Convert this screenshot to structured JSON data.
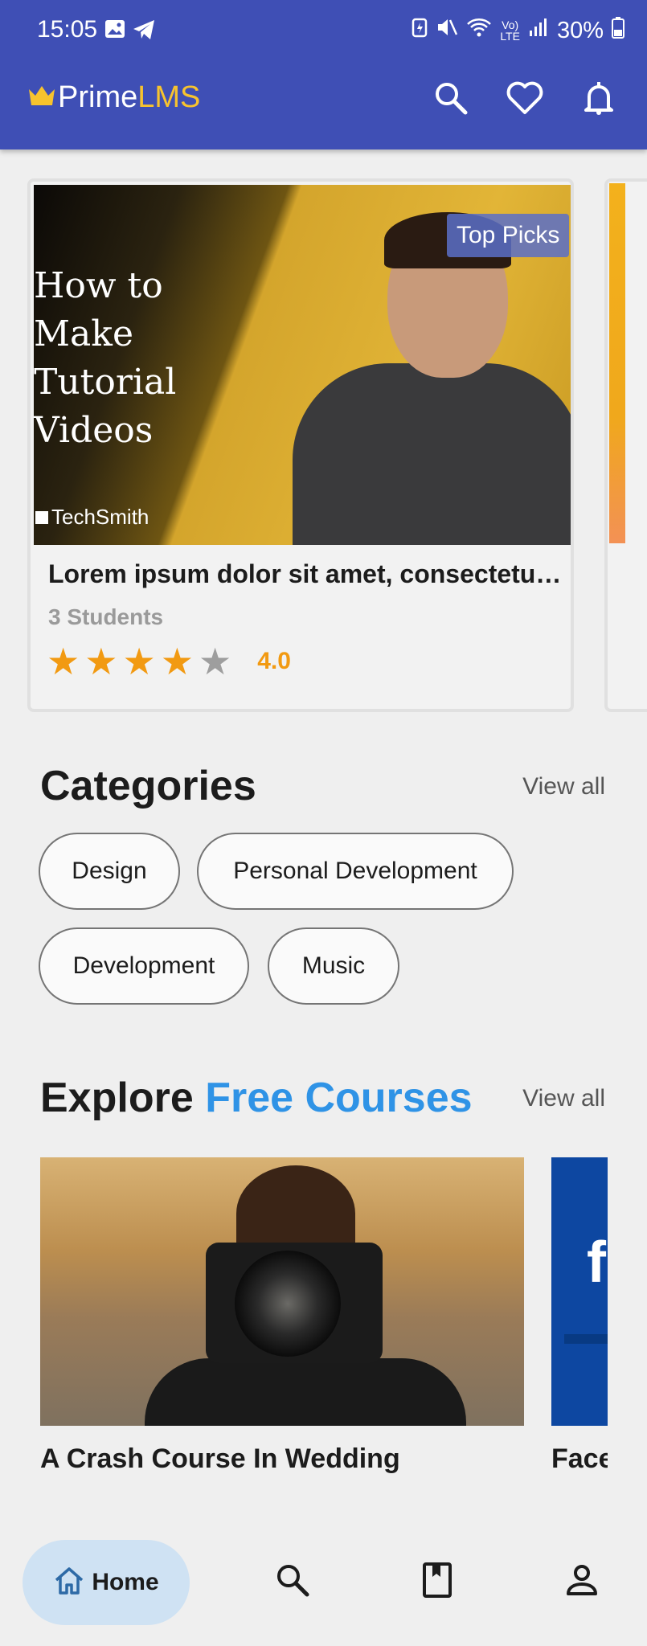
{
  "status_bar": {
    "time": "15:05",
    "battery": "30%",
    "icons": [
      "gallery-icon",
      "telegram-icon",
      "battery-saver-icon",
      "mute-icon",
      "wifi-icon",
      "volte-icon",
      "signal-icon",
      "battery-icon"
    ]
  },
  "app_bar": {
    "brand_part1": "Prime",
    "brand_part2": "LMS",
    "brand_icon": "crown-icon",
    "actions": [
      "search-icon",
      "heart-icon",
      "bell-icon"
    ],
    "colors": {
      "bar": "#3f4fb5",
      "brand_accent": "#f7c32e"
    }
  },
  "featured": {
    "badge": "Top Picks",
    "thumbnail_text": [
      "How to",
      "Make",
      "Tutorial",
      "Videos"
    ],
    "thumbnail_brand": "TechSmith",
    "title": "Lorem ipsum dolor sit amet, consectetur adipiscing",
    "students": "3 Students",
    "rating": 4.0,
    "rating_text": "4.0",
    "stars_total": 5
  },
  "categories": {
    "title": "Categories",
    "view_all": "View all",
    "items": [
      "Design",
      "Personal Development",
      "Development",
      "Music"
    ]
  },
  "free_courses": {
    "title_part1": "Explore ",
    "title_part2": "Free Courses",
    "view_all": "View all",
    "courses": [
      {
        "title": "A Crash Course In Wedding"
      },
      {
        "title": "Face"
      }
    ]
  },
  "bottom_nav": {
    "home_label": "Home",
    "items": [
      "home-icon",
      "search-icon",
      "bookmark-icon",
      "profile-icon"
    ]
  }
}
